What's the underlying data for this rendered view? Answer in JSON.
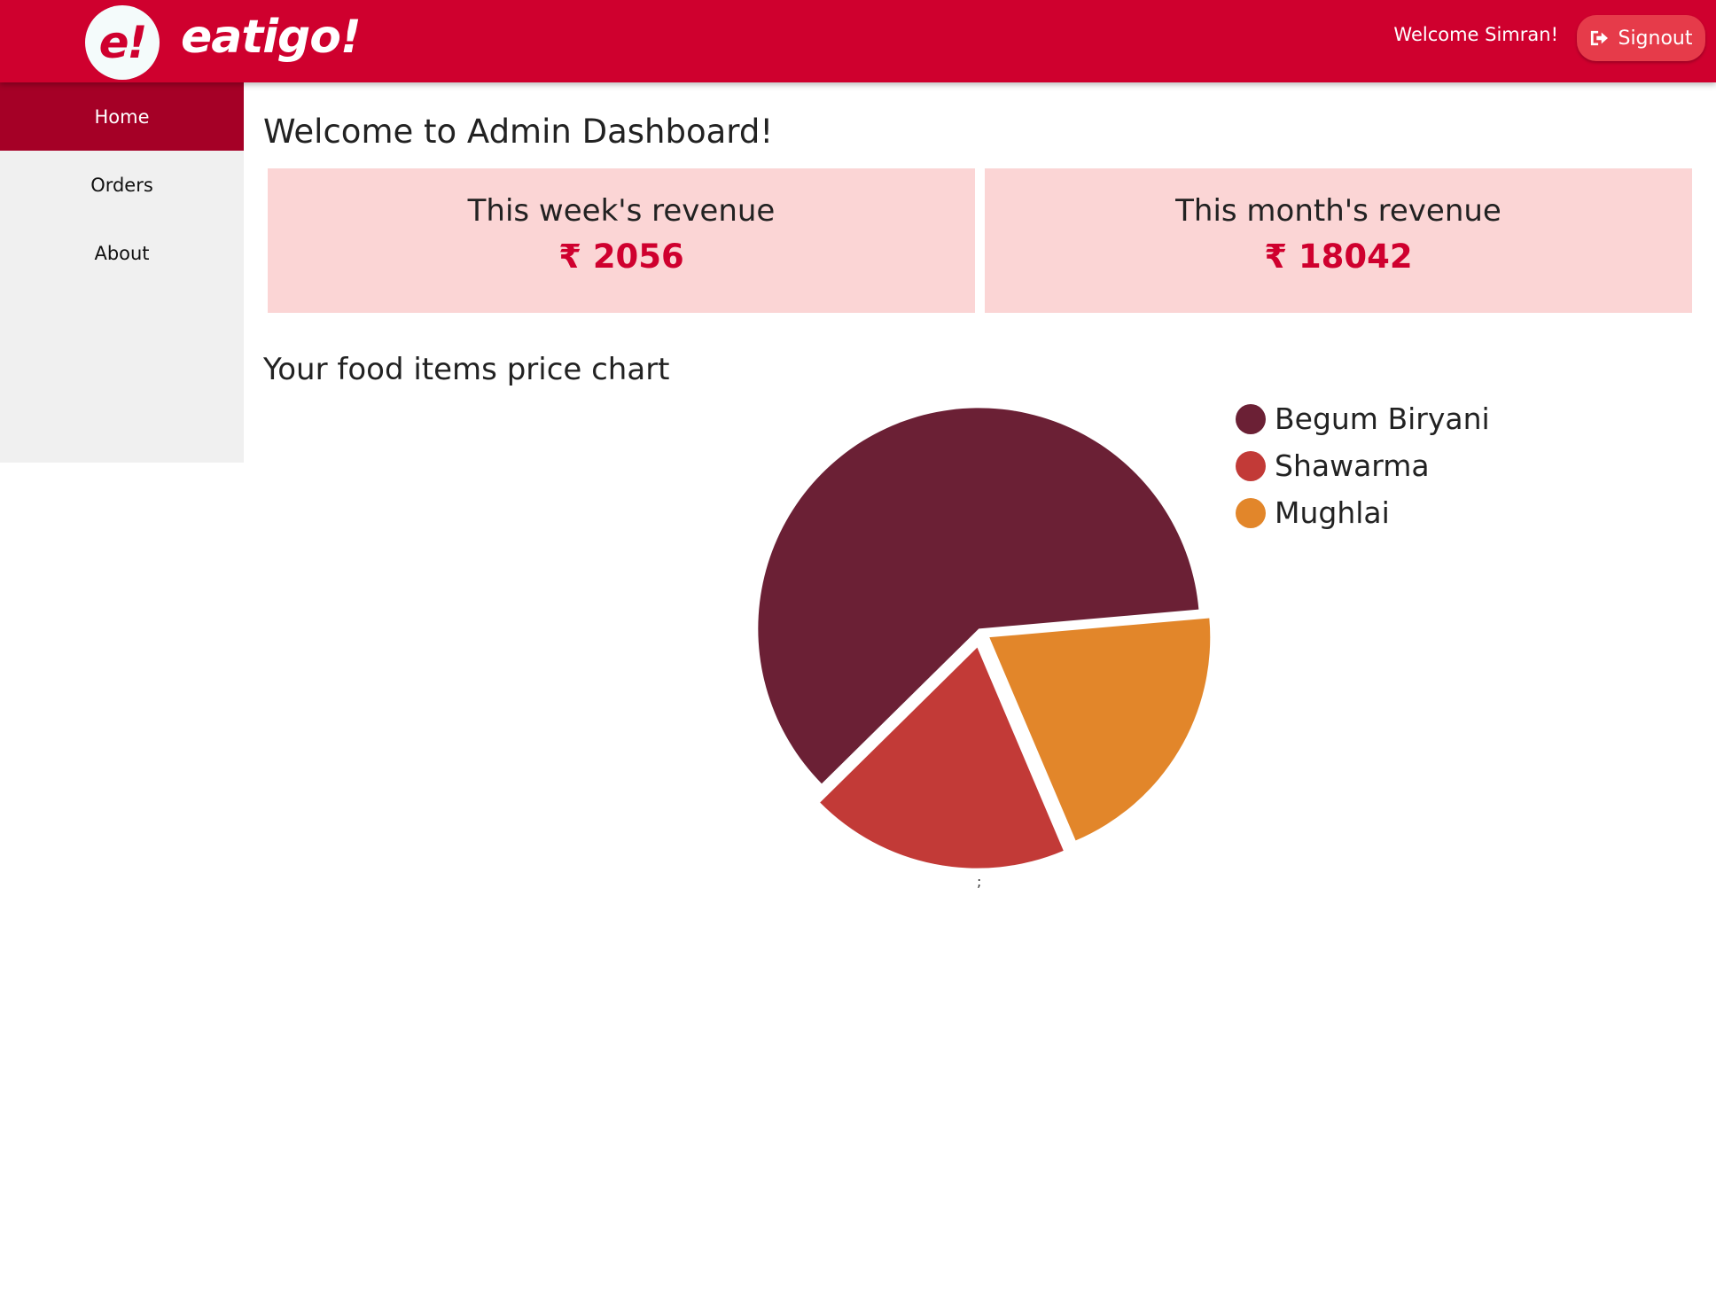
{
  "header": {
    "logo_mark": "e!",
    "brand": "eatigo!",
    "welcome": "Welcome Simran!",
    "signout_label": "Signout",
    "signout_icon": "sign-out-icon"
  },
  "sidebar": {
    "items": [
      {
        "label": "Home",
        "active": true
      },
      {
        "label": "Orders",
        "active": false
      },
      {
        "label": "About",
        "active": false
      }
    ]
  },
  "main": {
    "title": "Welcome to Admin Dashboard!",
    "cards": [
      {
        "label": "This week's revenue",
        "value": "₹ 2056"
      },
      {
        "label": "This month's revenue",
        "value": "₹ 18042"
      }
    ],
    "chart_title": "Your food items price chart",
    "chart_footer": ";"
  },
  "colors": {
    "brand_red": "#cf002e",
    "sidebar_active": "#a50026",
    "card_bg": "#fbd5d5"
  },
  "chart_data": {
    "type": "pie",
    "title": "Your food items price chart",
    "categories": [
      "Begum Biryani",
      "Shawarma",
      "Mughlai"
    ],
    "values": [
      61,
      19,
      20
    ],
    "colors": [
      "#6b2035",
      "#c23a37",
      "#e2862a"
    ],
    "legend": "right",
    "exploded": true
  }
}
